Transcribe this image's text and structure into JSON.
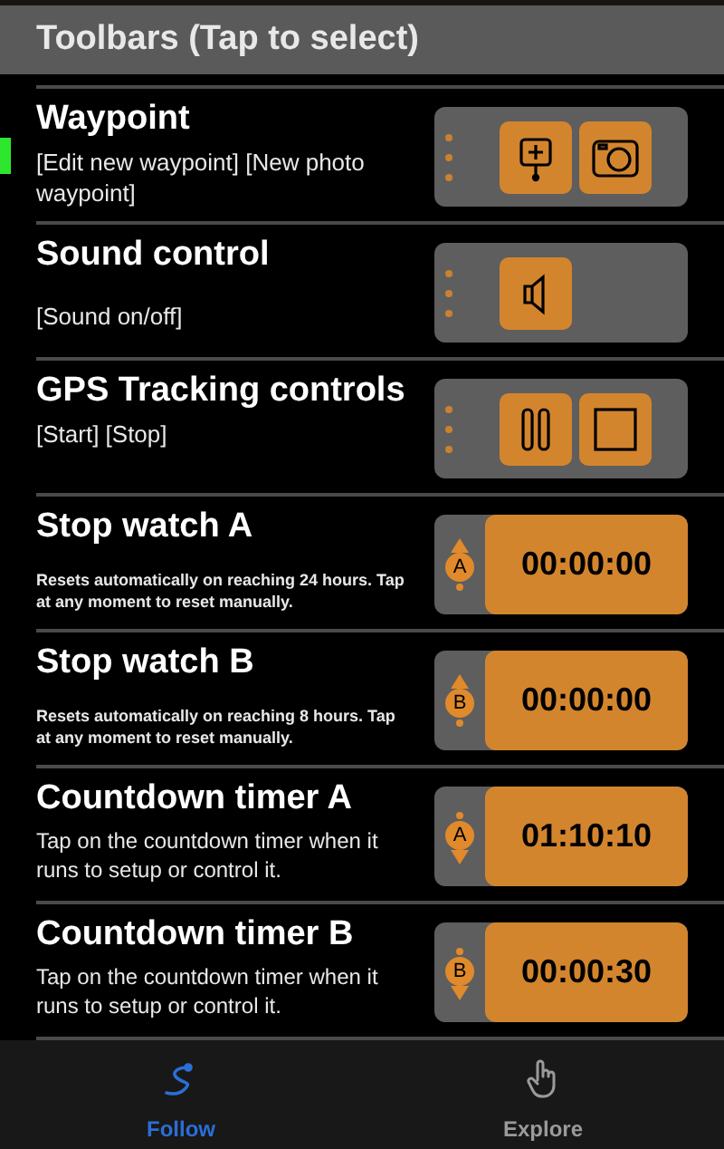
{
  "header": {
    "title": "Toolbars (Tap to select)"
  },
  "toolbars": [
    {
      "kind": "buttons",
      "selected": true,
      "title": "Waypoint",
      "description": "[Edit new waypoint] [New photo waypoint]",
      "buttons": [
        {
          "kind": "pin-plus"
        },
        {
          "kind": "camera"
        }
      ]
    },
    {
      "kind": "buttons",
      "selected": false,
      "title": "Sound control",
      "description": "[Sound on/off]",
      "buttons": [
        {
          "kind": "speaker"
        }
      ]
    },
    {
      "kind": "buttons",
      "selected": false,
      "title": "GPS Tracking controls",
      "description": "[Start] [Stop]",
      "buttons": [
        {
          "kind": "pause"
        },
        {
          "kind": "stop"
        }
      ]
    },
    {
      "kind": "stopwatch",
      "selected": false,
      "title": "Stop watch A",
      "description": "Resets automatically on reaching 24 hours. Tap at any moment to reset manually.",
      "letter": "A",
      "time": "00:00:00"
    },
    {
      "kind": "stopwatch",
      "selected": false,
      "title": "Stop watch B",
      "description": "Resets automatically on reaching 8 hours. Tap at any moment to reset manually.",
      "letter": "B",
      "time": "00:00:00"
    },
    {
      "kind": "countdown",
      "selected": false,
      "title": "Countdown timer A",
      "description": "Tap on the countdown timer when it runs to setup or control it.",
      "letter": "A",
      "time": "01:10:10"
    },
    {
      "kind": "countdown",
      "selected": false,
      "title": "Countdown timer B",
      "description": "Tap on the countdown timer when it runs to setup or control it.",
      "letter": "B",
      "time": "00:00:30"
    }
  ],
  "tab_bar": [
    {
      "label": "Follow",
      "kind": "route",
      "selected": true
    },
    {
      "label": "Explore",
      "kind": "hand",
      "selected": false
    }
  ]
}
